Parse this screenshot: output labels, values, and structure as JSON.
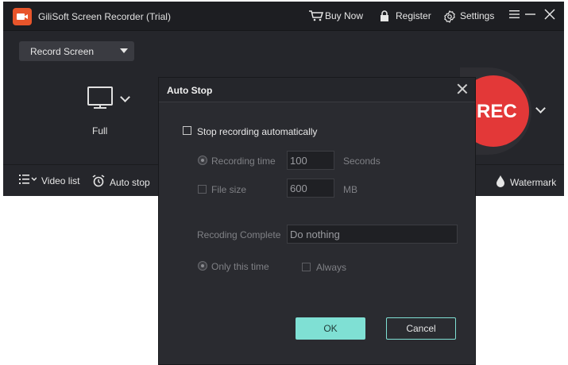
{
  "app": {
    "title": "GiliSoft Screen Recorder (Trial)",
    "buy_now": "Buy Now",
    "register": "Register",
    "settings": "Settings",
    "mode_select": "Record Screen",
    "capture_area": "Full",
    "rec_label": "REC",
    "video_list": "Video list",
    "auto_stop": "Auto stop",
    "watermark": "Watermark"
  },
  "dialog": {
    "title": "Auto Stop",
    "stop_automatically": "Stop recording automatically",
    "recording_time_label": "Recording time",
    "recording_time_value": "100",
    "recording_time_unit": "Seconds",
    "file_size_label": "File size",
    "file_size_value": "600",
    "file_size_unit": "MB",
    "complete_label": "Recoding Complete",
    "complete_value": "Do nothing",
    "only_this_time": "Only this time",
    "always": "Always",
    "ok": "OK",
    "cancel": "Cancel"
  },
  "colors": {
    "accent": "#7fe0d4",
    "rec": "#e33838",
    "brand": "#e8552b"
  }
}
